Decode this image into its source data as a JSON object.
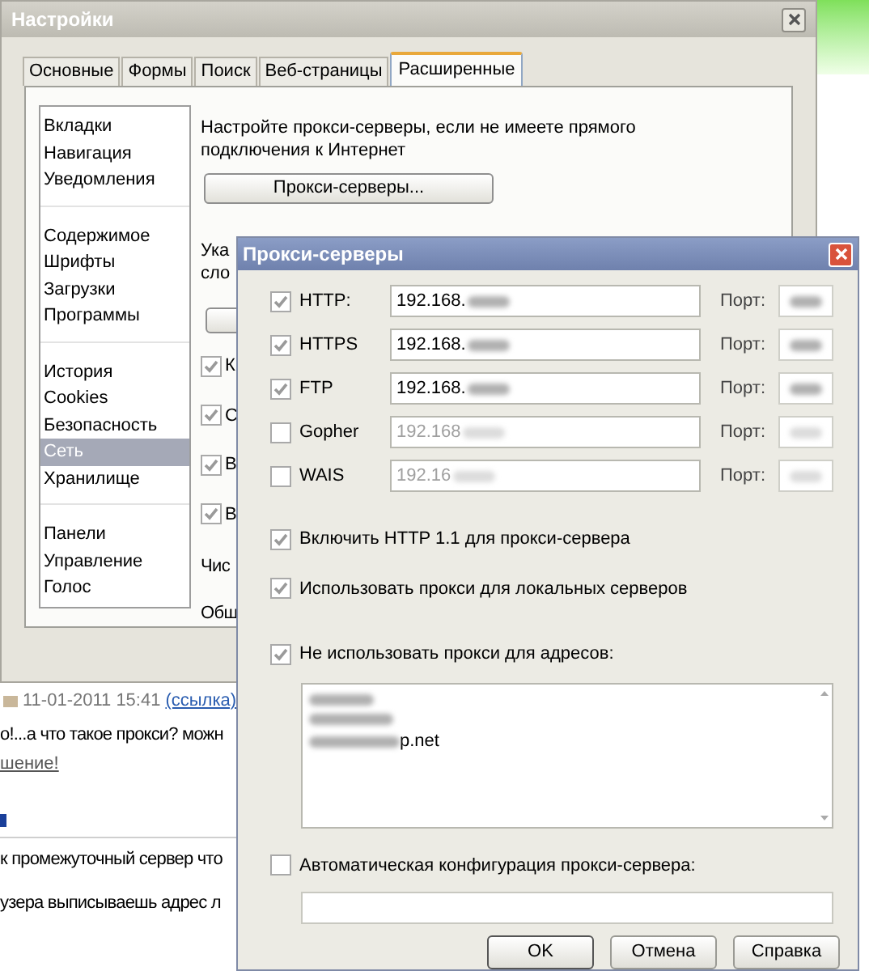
{
  "settings_window": {
    "title": "Настройки",
    "tabs": [
      {
        "label": "Основные",
        "selected": false
      },
      {
        "label": "Формы",
        "selected": false
      },
      {
        "label": "Поиск",
        "selected": false
      },
      {
        "label": "Веб-страницы",
        "selected": false
      },
      {
        "label": "Расширенные",
        "selected": true
      }
    ],
    "sidebar": {
      "groups": [
        {
          "items": [
            {
              "label": "Вкладки",
              "selected": false
            },
            {
              "label": "Навигация",
              "selected": false
            },
            {
              "label": "Уведомления",
              "selected": false
            }
          ]
        },
        {
          "items": [
            {
              "label": "Содержимое",
              "selected": false
            },
            {
              "label": "Шрифты",
              "selected": false
            },
            {
              "label": "Загрузки",
              "selected": false
            },
            {
              "label": "Программы",
              "selected": false
            }
          ]
        },
        {
          "items": [
            {
              "label": "История",
              "selected": false
            },
            {
              "label": "Cookies",
              "selected": false
            },
            {
              "label": "Безопасность",
              "selected": false
            },
            {
              "label": "Сеть",
              "selected": true
            },
            {
              "label": "Хранилище",
              "selected": false
            }
          ]
        },
        {
          "items": [
            {
              "label": "Панели",
              "selected": false
            },
            {
              "label": "Управление",
              "selected": false
            },
            {
              "label": "Голос",
              "selected": false
            }
          ]
        }
      ]
    },
    "intro_text": "Настройте прокси-серверы, если не имеете прямого подключения к Интернет",
    "proxy_button": "Прокси-серверы...",
    "partial_text_lines": [
      "Ука",
      "сло"
    ],
    "options": [
      {
        "label": "К",
        "checked": true
      },
      {
        "label": "С",
        "checked": true
      },
      {
        "label": "В",
        "checked": true
      },
      {
        "label": "В",
        "checked": true
      }
    ],
    "partial_labels": [
      "Чис",
      "Общ"
    ]
  },
  "proxy_dialog": {
    "title": "Прокси-серверы",
    "protocols": [
      {
        "label": "HTTP:",
        "checked": true,
        "address": "192.168.",
        "port_label": "Порт:"
      },
      {
        "label": "HTTPS",
        "checked": true,
        "address": "192.168.",
        "port_label": "Порт:"
      },
      {
        "label": "FTP",
        "checked": true,
        "address": "192.168.",
        "port_label": "Порт:"
      },
      {
        "label": "Gopher",
        "checked": false,
        "address": "192.168",
        "port_label": "Порт:"
      },
      {
        "label": "WAIS",
        "checked": false,
        "address": "192.16",
        "port_label": "Порт:"
      }
    ],
    "options": [
      {
        "label": "Включить HTTP 1.1 для прокси-сервера",
        "checked": true
      },
      {
        "label": "Использовать прокси для локальных серверов",
        "checked": true
      }
    ],
    "exclude": {
      "label": "Не использовать прокси для адресов:",
      "checked": true,
      "last_line": "p.net"
    },
    "auto_config": {
      "label": "Автоматическая конфигурация прокси-сервера:",
      "checked": false
    },
    "buttons": [
      "OK",
      "Отмена",
      "Справка"
    ]
  },
  "background_page": {
    "date": "11-01-2011 15:41",
    "link": "(ссылка)",
    "comment": "о!...а что такое прокси? можн",
    "reply_link": "шение!",
    "answer_lines": [
      "к промежуточный сервер что",
      "узера выписываешь адрес л"
    ]
  }
}
